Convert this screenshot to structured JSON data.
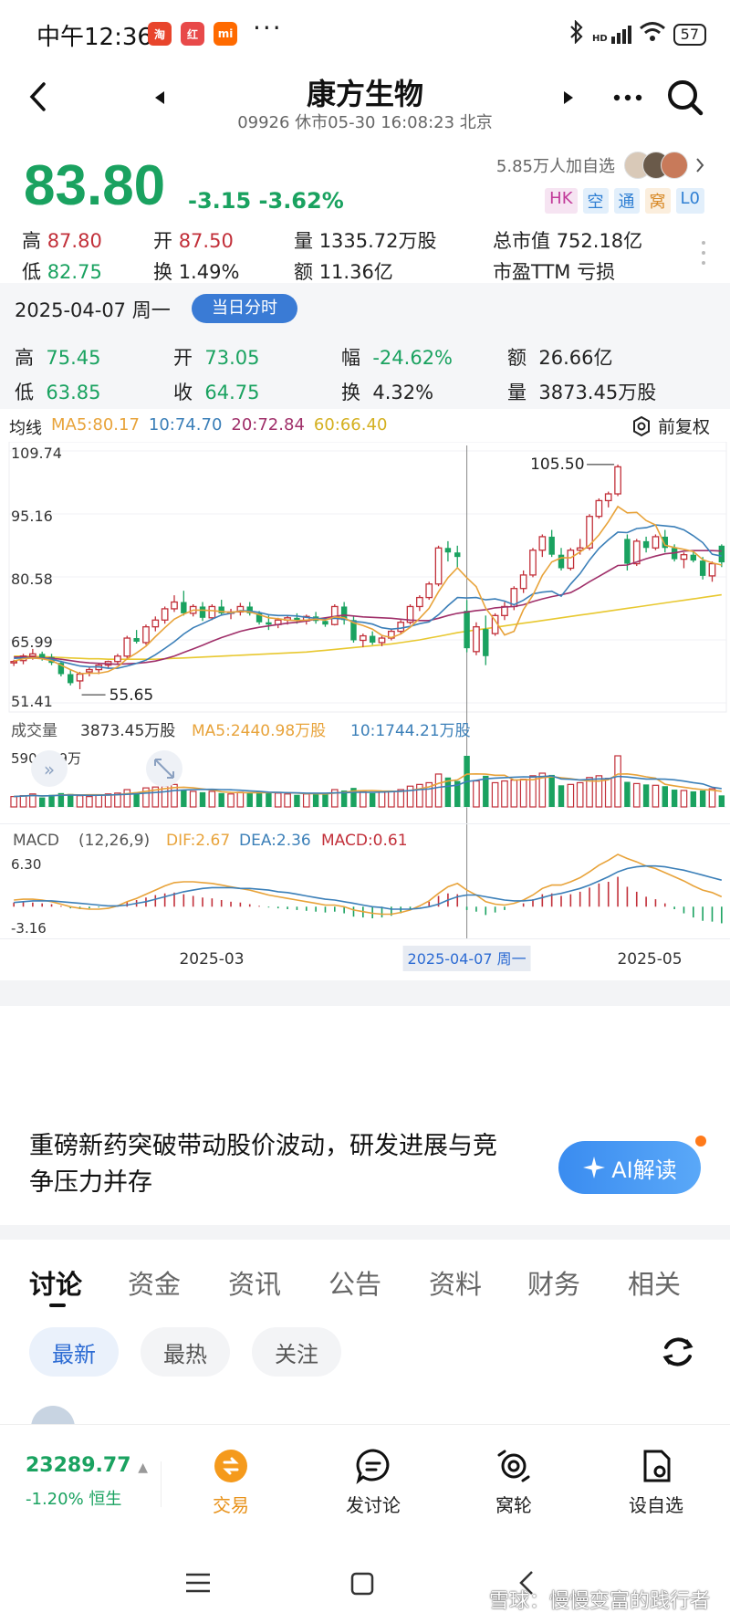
{
  "status": {
    "time": "中午12:36",
    "apps": [
      "淘",
      "红",
      "mi"
    ],
    "dots": "···",
    "network": "HD",
    "battery": "57"
  },
  "header": {
    "title": "康方生物",
    "subtitle": "09926 休市05-30 16:08:23 北京"
  },
  "quote": {
    "price": "83.80",
    "change": "-3.15  -3.62%",
    "watchers": "5.85万人加自选",
    "tags": [
      "HK",
      "空",
      "通",
      "窝",
      "L0"
    ]
  },
  "stats": {
    "high_label": "高",
    "high": "87.80",
    "open_label": "开",
    "open": "87.50",
    "vol_label": "量",
    "vol": "1335.72万股",
    "mcap_label": "总市值",
    "mcap": "752.18亿",
    "low_label": "低",
    "low": "82.75",
    "turn_label": "换",
    "turn": "1.49%",
    "amt_label": "额",
    "amt": "11.36亿",
    "pe_label": "市盈TTM",
    "pe": "亏损"
  },
  "day": {
    "date": "2025-04-07 周一",
    "pill": "当日分时",
    "high_label": "高",
    "high": "75.45",
    "open_label": "开",
    "open": "73.05",
    "amp_label": "幅",
    "amp": "-24.62%",
    "amt_label": "额",
    "amt": "26.66亿",
    "low_label": "低",
    "low": "63.85",
    "close_label": "收",
    "close": "64.75",
    "turn_label": "换",
    "turn": "4.32%",
    "vol_label": "量",
    "vol": "3873.45万股"
  },
  "ma": {
    "label": "均线",
    "ma5": "MA5:80.17",
    "ma10": "10:74.70",
    "ma20": "20:72.84",
    "ma60": "60:66.40",
    "fq": "前复权"
  },
  "colors": {
    "up": "#c2303a",
    "down": "#1aa260",
    "ma5": "#e8a33a",
    "ma10": "#3b7fb8",
    "ma20": "#a0306a",
    "ma60": "#e8c830"
  },
  "chart_data": {
    "type": "candlestick",
    "y_ticks": [
      "109.74",
      "95.16",
      "80.58",
      "65.99",
      "51.41"
    ],
    "ylim": [
      51.41,
      109.74
    ],
    "max_label": "105.50",
    "min_label": "55.65",
    "x_ticks": [
      "2025-03",
      "2025-04-07 周一",
      "2025-05"
    ],
    "volume": {
      "label": "成交量",
      "value": "3873.45万股",
      "ma5": "MA5:2440.98万股",
      "ma10": "10:1744.21万股",
      "max": "5906.19万"
    },
    "macd": {
      "label": "MACD",
      "params": "(12,26,9)",
      "dif": "DIF:2.67",
      "dea": "DEA:2.36",
      "macd": "MACD:0.61",
      "top": "6.30",
      "bottom": "-3.16"
    },
    "candles": [
      [
        61.5,
        62.2,
        60.8,
        61.8
      ],
      [
        62.0,
        63.5,
        61.2,
        63.0
      ],
      [
        63.0,
        64.6,
        62.2,
        63.5
      ],
      [
        63.5,
        64.0,
        62.0,
        62.5
      ],
      [
        62.8,
        63.5,
        61.0,
        61.5
      ],
      [
        61.5,
        62.0,
        58.5,
        59.0
      ],
      [
        59.0,
        60.0,
        56.5,
        57.0
      ],
      [
        57.5,
        59.5,
        55.65,
        59.0
      ],
      [
        59.5,
        60.5,
        58.5,
        60.0
      ],
      [
        60.0,
        61.5,
        59.0,
        61.0
      ],
      [
        61.0,
        62.0,
        60.2,
        61.8
      ],
      [
        61.8,
        63.5,
        61.0,
        63.0
      ],
      [
        63.0,
        67.5,
        62.5,
        67.0
      ],
      [
        67.0,
        68.8,
        65.8,
        66.2
      ],
      [
        66.0,
        70.0,
        65.5,
        69.5
      ],
      [
        69.5,
        71.8,
        68.5,
        71.0
      ],
      [
        71.0,
        74.0,
        70.2,
        73.5
      ],
      [
        73.5,
        76.5,
        72.8,
        75.0
      ],
      [
        75.0,
        77.5,
        72.0,
        72.5
      ],
      [
        72.5,
        74.5,
        71.8,
        74.0
      ],
      [
        74.0,
        75.0,
        70.8,
        71.5
      ],
      [
        71.5,
        74.5,
        71.0,
        74.0
      ],
      [
        74.0,
        75.5,
        72.0,
        72.5
      ],
      [
        72.5,
        73.5,
        71.2,
        72.8
      ],
      [
        72.8,
        74.8,
        72.0,
        74.0
      ],
      [
        74.0,
        75.0,
        72.0,
        72.5
      ],
      [
        72.5,
        73.0,
        70.0,
        70.5
      ],
      [
        70.5,
        72.0,
        68.8,
        70.0
      ],
      [
        70.0,
        71.5,
        69.2,
        71.0
      ],
      [
        71.0,
        72.0,
        70.0,
        71.5
      ],
      [
        71.5,
        72.5,
        70.2,
        70.8
      ],
      [
        70.8,
        72.2,
        70.0,
        71.8
      ],
      [
        71.8,
        72.8,
        70.2,
        70.8
      ],
      [
        70.8,
        71.5,
        69.5,
        70.0
      ],
      [
        70.0,
        74.5,
        69.8,
        74.0
      ],
      [
        74.0,
        75.0,
        70.0,
        71.0
      ],
      [
        71.0,
        71.8,
        66.0,
        66.5
      ],
      [
        66.5,
        68.0,
        65.0,
        67.5
      ],
      [
        67.5,
        68.5,
        65.5,
        66.0
      ],
      [
        66.0,
        67.5,
        65.2,
        67.0
      ],
      [
        67.0,
        69.0,
        66.5,
        68.5
      ],
      [
        68.5,
        71.0,
        68.0,
        70.5
      ],
      [
        70.5,
        74.5,
        70.0,
        74.0
      ],
      [
        74.0,
        76.5,
        73.0,
        76.0
      ],
      [
        76.0,
        79.5,
        75.5,
        79.0
      ],
      [
        79.0,
        87.5,
        78.5,
        87.0
      ],
      [
        87.0,
        88.5,
        84.0,
        86.0
      ],
      [
        86.0,
        87.5,
        82.5,
        85.0
      ],
      [
        73.05,
        75.45,
        63.85,
        64.75
      ],
      [
        64.0,
        70.5,
        63.2,
        69.5
      ],
      [
        69.0,
        72.0,
        61.0,
        63.0
      ],
      [
        68.0,
        72.5,
        67.5,
        72.0
      ],
      [
        72.0,
        75.0,
        71.0,
        74.0
      ],
      [
        74.0,
        78.5,
        73.2,
        78.0
      ],
      [
        78.0,
        82.0,
        77.0,
        81.0
      ],
      [
        81.0,
        87.0,
        80.5,
        86.5
      ],
      [
        86.5,
        90.0,
        85.0,
        89.5
      ],
      [
        89.5,
        91.0,
        85.0,
        85.5
      ],
      [
        85.5,
        87.0,
        82.0,
        82.5
      ],
      [
        82.5,
        87.0,
        82.0,
        86.5
      ],
      [
        86.5,
        89.0,
        85.5,
        87.0
      ],
      [
        87.0,
        94.5,
        86.5,
        94.0
      ],
      [
        94.0,
        98.0,
        93.5,
        97.5
      ],
      [
        97.5,
        99.5,
        96.0,
        99.0
      ],
      [
        99.0,
        105.5,
        98.5,
        105.0
      ],
      [
        89.0,
        90.0,
        82.0,
        83.5
      ],
      [
        83.5,
        89.0,
        83.0,
        88.5
      ],
      [
        88.5,
        89.5,
        86.0,
        87.0
      ],
      [
        87.0,
        90.0,
        86.5,
        89.5
      ],
      [
        89.5,
        91.0,
        86.0,
        87.0
      ],
      [
        87.0,
        87.8,
        84.0,
        84.5
      ],
      [
        84.5,
        86.0,
        82.5,
        85.5
      ],
      [
        85.5,
        86.5,
        83.8,
        84.2
      ],
      [
        84.2,
        85.0,
        80.0,
        80.8
      ],
      [
        80.8,
        84.0,
        79.5,
        83.5
      ],
      [
        87.5,
        87.8,
        82.75,
        83.8
      ]
    ],
    "ma5_line": [
      61.9,
      62.4,
      62.6,
      62.4,
      62.0,
      61.0,
      60.0,
      59.1,
      59.2,
      59.2,
      59.6,
      60.6,
      62.4,
      63.7,
      65.2,
      67.3,
      69.3,
      71.2,
      72.3,
      73.2,
      73.2,
      73.1,
      72.9,
      72.7,
      73.0,
      72.8,
      72.2,
      71.5,
      71.3,
      71.0,
      70.9,
      71.0,
      71.2,
      71.0,
      71.7,
      71.5,
      70.4,
      69.8,
      69.0,
      67.6,
      67.1,
      67.9,
      69.4,
      71.4,
      73.6,
      77.3,
      80.4,
      82.6,
      80.4,
      78.4,
      73.6,
      70.9,
      67.7,
      68.5,
      73.3,
      76.5,
      80.9,
      83.9,
      84.8,
      84.8,
      86.1,
      87.6,
      89.9,
      92.8,
      96.2,
      94.8,
      94.9,
      93.1,
      92.1,
      87.6,
      87.1,
      86.7,
      86.2,
      84.4,
      83.7,
      83.2
    ],
    "ma10_line": [
      62.5,
      62.6,
      62.6,
      62.5,
      62.3,
      61.8,
      61.3,
      60.8,
      60.6,
      60.6,
      60.3,
      60.3,
      60.8,
      61.4,
      62.1,
      63.3,
      64.7,
      66.2,
      67.9,
      69.3,
      70.2,
      71.2,
      72.1,
      72.5,
      73.1,
      73.0,
      72.7,
      72.2,
      72.0,
      72.0,
      71.9,
      71.6,
      71.4,
      71.2,
      71.4,
      71.2,
      70.7,
      70.5,
      70.1,
      69.3,
      69.0,
      69.2,
      69.6,
      70.2,
      70.6,
      72.2,
      74.2,
      76.0,
      75.9,
      76.0,
      75.5,
      75.7,
      75.2,
      74.4,
      75.4,
      76.8,
      77.2,
      77.4,
      76.3,
      79.0,
      81.3,
      84.3,
      86.9,
      88.8,
      90.5,
      90.4,
      91.3,
      91.5,
      92.1,
      91.9,
      91.7,
      91.0,
      89.7,
      88.2,
      85.6,
      85.2
    ],
    "ma20_line": [
      62.8,
      62.8,
      62.7,
      62.6,
      62.5,
      62.3,
      62.0,
      61.7,
      61.5,
      61.4,
      61.3,
      61.2,
      61.3,
      61.4,
      61.6,
      61.9,
      62.4,
      63.0,
      63.8,
      64.6,
      65.4,
      66.3,
      67.1,
      67.8,
      68.5,
      69.0,
      69.4,
      69.7,
      70.0,
      70.3,
      70.5,
      70.8,
      71.2,
      71.5,
      71.8,
      72.1,
      71.9,
      71.7,
      71.6,
      71.5,
      71.4,
      71.2,
      71.0,
      70.9,
      70.9,
      71.4,
      72.0,
      72.5,
      72.8,
      73.1,
      73.3,
      73.7,
      73.9,
      74.0,
      74.4,
      75.1,
      75.7,
      76.2,
      76.6,
      77.1,
      78.2,
      79.5,
      80.7,
      81.9,
      83.1,
      83.2,
      83.9,
      84.6,
      85.2,
      85.7,
      85.9,
      86.3,
      86.4,
      86.4,
      86.4,
      86.3
    ],
    "ma60_line": [
      63.0,
      63.0,
      62.9,
      62.9,
      62.8,
      62.7,
      62.6,
      62.5,
      62.4,
      62.4,
      62.3,
      62.3,
      62.3,
      62.3,
      62.3,
      62.3,
      62.4,
      62.5,
      62.6,
      62.7,
      62.8,
      62.9,
      63.0,
      63.1,
      63.2,
      63.3,
      63.4,
      63.5,
      63.6,
      63.7,
      63.8,
      63.9,
      64.1,
      64.3,
      64.5,
      64.7,
      64.9,
      65.1,
      65.3,
      65.5,
      65.7,
      66.0,
      66.3,
      66.6,
      67.0,
      67.4,
      67.8,
      68.2,
      68.5,
      68.8,
      69.1,
      69.4,
      69.7,
      70.0,
      70.3,
      70.6,
      70.9,
      71.2,
      71.5,
      71.8,
      72.1,
      72.4,
      72.7,
      73.0,
      73.3,
      73.6,
      73.9,
      74.2,
      74.5,
      74.8,
      75.1,
      75.4,
      75.7,
      76.0,
      76.3,
      76.6
    ],
    "volumes": [
      1200,
      1300,
      1500,
      1100,
      1400,
      1600,
      1500,
      1300,
      1200,
      1400,
      1500,
      1600,
      2000,
      1700,
      2200,
      2300,
      2400,
      2600,
      1900,
      1800,
      1700,
      1800,
      1600,
      1500,
      1700,
      1600,
      1800,
      1700,
      1600,
      1500,
      1400,
      1500,
      1600,
      1500,
      2000,
      1900,
      2200,
      1800,
      1600,
      1700,
      1800,
      2000,
      2400,
      2600,
      2800,
      3800,
      3400,
      3000,
      5906,
      3000,
      3600,
      2800,
      3000,
      3100,
      3200,
      3600,
      3900,
      3700,
      2500,
      2600,
      2800,
      3400,
      3600,
      3300,
      5906,
      2900,
      2700,
      2600,
      2500,
      2400,
      2000,
      1900,
      1800,
      1900,
      2100,
      1335
    ],
    "macd_hist": [
      0.5,
      0.6,
      0.5,
      0.4,
      0.3,
      0.1,
      -0.2,
      -0.3,
      -0.2,
      -0.1,
      0.0,
      0.2,
      0.6,
      0.8,
      1.1,
      1.4,
      1.6,
      1.7,
      1.5,
      1.3,
      1.1,
      1.0,
      0.8,
      0.6,
      0.5,
      0.3,
      0.1,
      -0.1,
      -0.2,
      -0.3,
      -0.4,
      -0.5,
      -0.6,
      -0.7,
      -0.6,
      -0.8,
      -1.2,
      -1.3,
      -1.4,
      -1.3,
      -1.1,
      -0.8,
      -0.4,
      0.1,
      0.6,
      1.3,
      1.6,
      1.5,
      -0.4,
      -0.6,
      -1.0,
      -0.7,
      -0.4,
      0.0,
      0.4,
      0.9,
      1.5,
      1.6,
      1.3,
      1.5,
      1.8,
      2.3,
      2.8,
      3.0,
      3.6,
      2.4,
      1.8,
      1.2,
      0.9,
      0.4,
      -0.3,
      -0.8,
      -1.3,
      -1.7,
      -1.8,
      -2.0
    ],
    "dif_line": [
      0.8,
      0.9,
      0.9,
      0.8,
      0.6,
      0.3,
      0.0,
      -0.2,
      -0.3,
      -0.3,
      -0.2,
      0.1,
      0.6,
      1.0,
      1.5,
      2.0,
      2.5,
      2.9,
      3.0,
      3.0,
      2.9,
      2.8,
      2.6,
      2.4,
      2.2,
      2.0,
      1.7,
      1.4,
      1.2,
      1.0,
      0.8,
      0.6,
      0.4,
      0.2,
      0.2,
      0.0,
      -0.4,
      -0.6,
      -0.8,
      -0.9,
      -0.9,
      -0.7,
      -0.4,
      0.1,
      0.7,
      1.6,
      2.4,
      2.8,
      2.0,
      1.4,
      0.6,
      0.3,
      0.2,
      0.4,
      0.8,
      1.4,
      2.2,
      2.6,
      2.6,
      3.0,
      3.5,
      4.2,
      5.0,
      5.6,
      6.3,
      5.8,
      5.4,
      4.9,
      4.6,
      4.1,
      3.6,
      3.1,
      2.5,
      2.0,
      1.7,
      1.2
    ],
    "dea_line": [
      0.5,
      0.6,
      0.7,
      0.7,
      0.7,
      0.6,
      0.5,
      0.4,
      0.3,
      0.2,
      0.1,
      0.1,
      0.2,
      0.4,
      0.6,
      0.9,
      1.2,
      1.5,
      1.8,
      2.0,
      2.2,
      2.3,
      2.3,
      2.3,
      2.2,
      2.2,
      2.1,
      2.0,
      1.8,
      1.7,
      1.5,
      1.3,
      1.1,
      0.9,
      0.8,
      0.6,
      0.4,
      0.2,
      0.0,
      -0.1,
      -0.3,
      -0.3,
      -0.3,
      -0.2,
      0.0,
      0.3,
      0.8,
      1.2,
      1.4,
      1.4,
      1.2,
      1.0,
      0.8,
      0.7,
      0.7,
      0.8,
      1.1,
      1.4,
      1.6,
      1.9,
      2.2,
      2.6,
      3.1,
      3.6,
      4.2,
      4.6,
      4.8,
      4.9,
      4.9,
      4.8,
      4.6,
      4.4,
      4.1,
      3.8,
      3.5,
      3.2
    ]
  },
  "ai": {
    "headline": "重磅新药突破带动股价波动，研发进展与竞争压力并存",
    "button": "AI解读"
  },
  "tabs": [
    "讨论",
    "资金",
    "资讯",
    "公告",
    "资料",
    "财务",
    "相关"
  ],
  "subtabs": [
    "最新",
    "最热",
    "关注"
  ],
  "bottom": {
    "index_value": "23289.77",
    "index_change": "-1.20% 恒生",
    "nav": [
      "交易",
      "发讨论",
      "窝轮",
      "设自选"
    ]
  },
  "watermark": "雪球：慢慢变富的践行者"
}
